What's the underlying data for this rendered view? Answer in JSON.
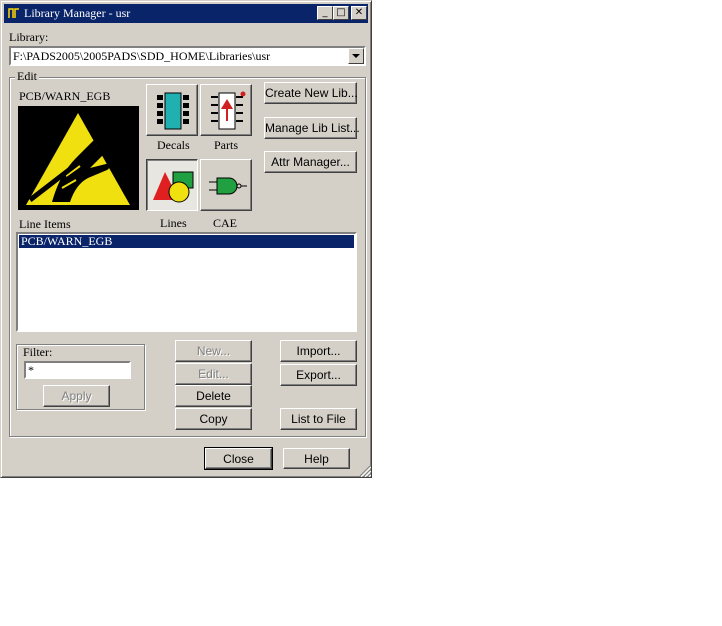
{
  "window": {
    "title": "Library Manager - usr",
    "controls": {
      "minimize": "_",
      "maximize": "□",
      "close": "✕"
    }
  },
  "library": {
    "label": "Library:",
    "selected": "F:\\PADS2005\\2005PADS\\SDD_HOME\\Libraries\\usr"
  },
  "edit": {
    "group_label": "Edit",
    "preview_title": "PCB/WARN_EGB",
    "types": [
      {
        "label": "Decals",
        "icon": "decals-icon",
        "selected": false
      },
      {
        "label": "Parts",
        "icon": "parts-icon",
        "selected": false
      },
      {
        "label": "Lines",
        "icon": "lines-icon",
        "selected": true
      },
      {
        "label": "CAE",
        "icon": "cae-icon",
        "selected": false
      }
    ],
    "side_buttons": [
      "Create New Lib...",
      "Manage Lib List...",
      "Attr Manager..."
    ],
    "list_label": "Line Items",
    "list_items": [
      "PCB/WARN_EGB"
    ],
    "filter": {
      "label": "Filter:",
      "value": "*",
      "apply_label": "Apply"
    },
    "actions": {
      "new": "New...",
      "edit": "Edit...",
      "delete": "Delete",
      "copy": "Copy",
      "import": "Import...",
      "export": "Export...",
      "list_to_file": "List to File"
    }
  },
  "footer": {
    "close": "Close",
    "help": "Help"
  },
  "colors": {
    "face": "#d4d0c8",
    "title_bar": "#0a246a",
    "selection": "#0a246a",
    "warning_yellow": "#f0e010"
  }
}
